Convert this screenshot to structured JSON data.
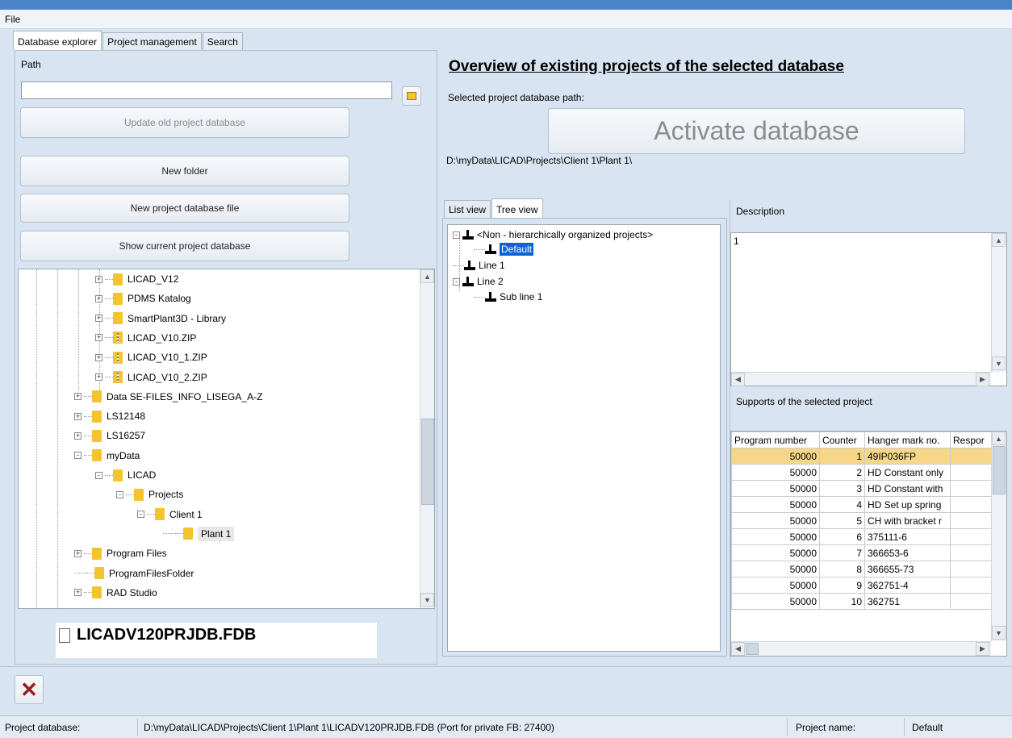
{
  "menu": {
    "file": "File"
  },
  "main_tabs": [
    "Database explorer",
    "Project management",
    "Search"
  ],
  "left": {
    "path_label": "Path",
    "path_value": "",
    "buttons": {
      "update": "Update old project database",
      "new_folder": "New folder",
      "new_db_file": "New project database file",
      "show_current": "Show current project database"
    },
    "tree": [
      {
        "label": "LICAD_V12",
        "type": "folder",
        "exp": "+"
      },
      {
        "label": "PDMS Katalog",
        "type": "folder",
        "exp": "+"
      },
      {
        "label": "SmartPlant3D - Library",
        "type": "folder",
        "exp": "+"
      },
      {
        "label": "LICAD_V10.ZIP",
        "type": "zip",
        "exp": "+"
      },
      {
        "label": "LICAD_V10_1.ZIP",
        "type": "zip",
        "exp": "+"
      },
      {
        "label": "LICAD_V10_2.ZIP",
        "type": "zip",
        "exp": "+"
      },
      {
        "label": "Data SE-FILES_INFO_LISEGA_A-Z",
        "type": "folder",
        "exp": "+"
      },
      {
        "label": "LS12148",
        "type": "folder",
        "exp": "+"
      },
      {
        "label": "LS16257",
        "type": "folder",
        "exp": "+"
      },
      {
        "label": "myData",
        "type": "folder",
        "exp": "-"
      },
      {
        "label": "LICAD",
        "type": "folder",
        "exp": "-"
      },
      {
        "label": "Projects",
        "type": "folder",
        "exp": "-"
      },
      {
        "label": "Client 1",
        "type": "folder",
        "exp": "-"
      },
      {
        "label": "Plant 1",
        "type": "folder",
        "exp": ""
      },
      {
        "label": "Program Files",
        "type": "folder",
        "exp": "+"
      },
      {
        "label": "ProgramFilesFolder",
        "type": "folder",
        "exp": ""
      },
      {
        "label": "RAD Studio",
        "type": "folder",
        "exp": "+"
      }
    ],
    "file_name": "LICADV120PRJDB.FDB"
  },
  "right": {
    "title": "Overview of existing projects of the selected database",
    "selected_path_label": "Selected project database path:",
    "activate_label": "Activate database",
    "path_value": "D:\\myData\\LICAD\\Projects\\Client 1\\Plant 1\\",
    "view_tabs": [
      "List view",
      "Tree view"
    ],
    "project_tree": [
      {
        "label": "<Non - hierarchically organized projects>",
        "exp": "-"
      },
      {
        "label": "Default",
        "exp": ""
      },
      {
        "label": "Line 1",
        "exp": ""
      },
      {
        "label": "Line 2",
        "exp": "-"
      },
      {
        "label": "Sub line 1",
        "exp": ""
      }
    ],
    "description_label": "Description",
    "description_value": "1",
    "supports_label": "Supports of the selected project",
    "supports": {
      "columns": [
        "Program number",
        "Counter",
        "Hanger mark no.",
        "Respor"
      ],
      "rows": [
        [
          "50000",
          "1",
          "49IP036FP",
          ""
        ],
        [
          "50000",
          "2",
          "HD Constant only",
          ""
        ],
        [
          "50000",
          "3",
          "HD Constant with",
          ""
        ],
        [
          "50000",
          "4",
          "HD Set up spring",
          ""
        ],
        [
          "50000",
          "5",
          "CH with bracket r",
          ""
        ],
        [
          "50000",
          "6",
          "375111-6",
          ""
        ],
        [
          "50000",
          "7",
          "366653-6",
          ""
        ],
        [
          "50000",
          "8",
          "366655-73",
          ""
        ],
        [
          "50000",
          "9",
          "362751-4",
          ""
        ],
        [
          "50000",
          "10",
          "362751",
          ""
        ]
      ]
    }
  },
  "status": {
    "db_label": "Project database:",
    "db_value": "D:\\myData\\LICAD\\Projects\\Client 1\\Plant 1\\LICADV120PRJDB.FDB (Port for private FB: 27400)",
    "project_label": "Project name:",
    "project_value": "Default"
  }
}
